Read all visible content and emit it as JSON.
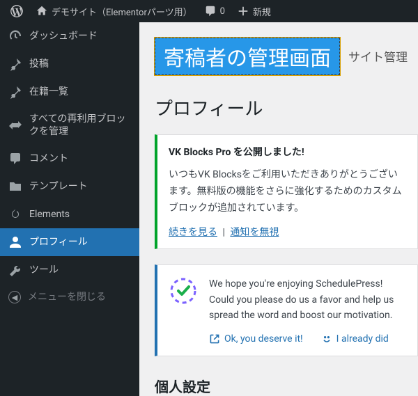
{
  "adminbar": {
    "site_title": "デモサイト（Elementorパーツ用）",
    "comments_count": "0",
    "new_label": "新規"
  },
  "sidebar": {
    "items": [
      {
        "label": "ダッシュボード"
      },
      {
        "label": "投稿"
      },
      {
        "label": "在籍一覧"
      },
      {
        "label": "すべての再利用ブロックを管理"
      },
      {
        "label": "コメント"
      },
      {
        "label": "テンプレート"
      },
      {
        "label": "Elements"
      },
      {
        "label": "プロフィール"
      },
      {
        "label": "ツール"
      }
    ],
    "collapse_label": "メニューを閉じる"
  },
  "main": {
    "highlight_text": "寄稿者の管理画面",
    "tab_right_text": "サイト管理",
    "page_heading": "プロフィール",
    "vk_notice": {
      "title": "VK Blocks Pro を公開しました!",
      "body": "いつもVK Blocksをご利用いただきありがとうございます。無料版の機能をさらに強化するためのカスタムブロックが追加されています。",
      "link_more": "続きを見る",
      "link_dismiss": "通知を無視"
    },
    "sp_notice": {
      "text": "We hope you're enjoying SchedulePress! Could you please do us a favor and help us spread the word and boost our motivation.",
      "action_ok": "Ok, you deserve it!",
      "action_done": "I already did"
    },
    "section_heading": "個人設定"
  }
}
